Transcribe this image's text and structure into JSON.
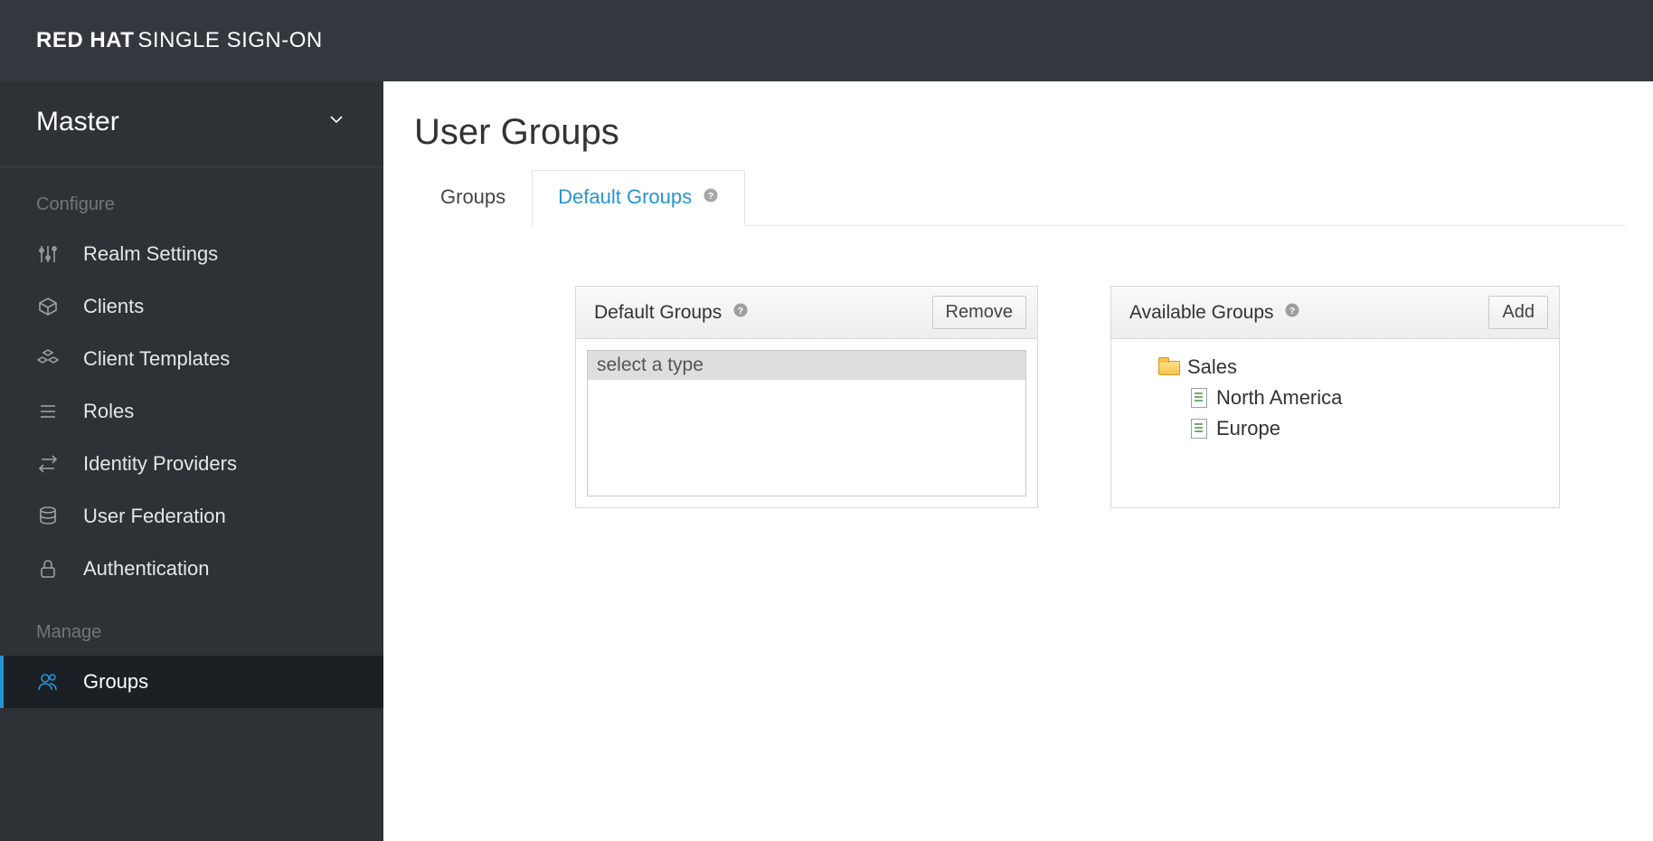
{
  "brand": {
    "bold": "RED HAT",
    "thin": "SINGLE SIGN-ON"
  },
  "sidebar": {
    "realm": "Master",
    "sections": [
      {
        "heading": "Configure",
        "items": [
          {
            "label": "Realm Settings",
            "icon": "sliders-icon"
          },
          {
            "label": "Clients",
            "icon": "cube-icon"
          },
          {
            "label": "Client Templates",
            "icon": "cubes-icon"
          },
          {
            "label": "Roles",
            "icon": "list-icon"
          },
          {
            "label": "Identity Providers",
            "icon": "exchange-icon"
          },
          {
            "label": "User Federation",
            "icon": "database-icon"
          },
          {
            "label": "Authentication",
            "icon": "lock-icon"
          }
        ]
      },
      {
        "heading": "Manage",
        "items": [
          {
            "label": "Groups",
            "icon": "users-icon",
            "active": true
          }
        ]
      }
    ]
  },
  "page": {
    "title": "User Groups",
    "tabs": [
      {
        "label": "Groups",
        "active": false,
        "help": false
      },
      {
        "label": "Default Groups",
        "active": true,
        "help": true
      }
    ]
  },
  "panels": {
    "default_groups": {
      "title": "Default Groups",
      "button": "Remove",
      "select_placeholder": "select a type"
    },
    "available_groups": {
      "title": "Available Groups",
      "button": "Add",
      "tree": {
        "label": "Sales",
        "children": [
          {
            "label": "North America"
          },
          {
            "label": "Europe"
          }
        ]
      }
    }
  }
}
